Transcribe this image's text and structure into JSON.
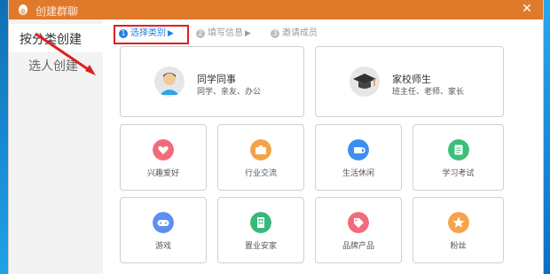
{
  "window": {
    "title": "创建群聊",
    "close_label": "✕"
  },
  "sidebar": {
    "items": [
      {
        "label": "按分类创建",
        "active": true
      },
      {
        "label": "选人创建",
        "active": false
      }
    ]
  },
  "steps": [
    {
      "num": "1",
      "label": "选择类别",
      "active": true
    },
    {
      "num": "2",
      "label": "填写信息",
      "active": false
    },
    {
      "num": "3",
      "label": "邀请成员",
      "active": false
    }
  ],
  "big_cards": [
    {
      "title": "同学同事",
      "subtitle": "同学、亲友、办公",
      "icon": "student-avatar-icon"
    },
    {
      "title": "家校师生",
      "subtitle": "班主任、老师、家长",
      "icon": "graduation-cap-icon"
    }
  ],
  "small_cards": [
    {
      "label": "兴趣爱好",
      "icon": "heart-icon",
      "color": "#f26b7a"
    },
    {
      "label": "行业交流",
      "icon": "briefcase-icon",
      "color": "#f5a34a"
    },
    {
      "label": "生活休闲",
      "icon": "coffee-cup-icon",
      "color": "#3b8ff0"
    },
    {
      "label": "学习考试",
      "icon": "notebook-icon",
      "color": "#3bbf7a"
    },
    {
      "label": "游戏",
      "icon": "gamepad-icon",
      "color": "#5c8ff0"
    },
    {
      "label": "置业安家",
      "icon": "building-icon",
      "color": "#36b97a"
    },
    {
      "label": "品牌产品",
      "icon": "tag-icon",
      "color": "#f26b7a"
    },
    {
      "label": "粉丝",
      "icon": "star-icon",
      "color": "#f5a34a"
    }
  ],
  "colors": {
    "title_bar": "#e07a2b",
    "accent": "#1f7fe3",
    "highlight_box": "#e01f1f",
    "arrow": "#e01f1f"
  }
}
